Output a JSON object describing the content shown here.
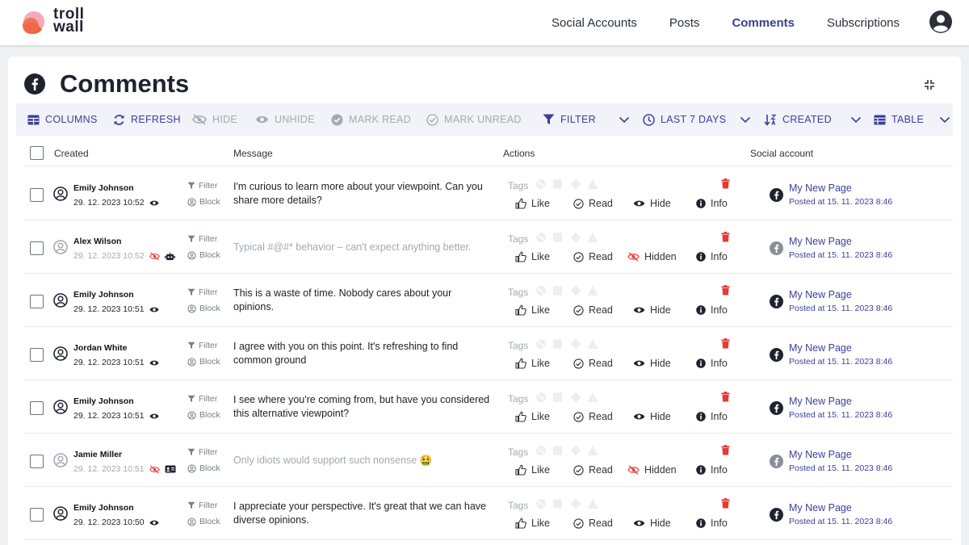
{
  "brand": {
    "line1": "troll",
    "line2": "wall"
  },
  "nav": [
    {
      "label": "Social Accounts",
      "active": false
    },
    {
      "label": "Posts",
      "active": false
    },
    {
      "label": "Comments",
      "active": true
    },
    {
      "label": "Subscriptions",
      "active": false
    }
  ],
  "page": {
    "title": "Comments"
  },
  "toolbar": {
    "columns": "COLUMNS",
    "refresh": "REFRESH",
    "hide": "HIDE",
    "unhide": "UNHIDE",
    "mark_read": "MARK READ",
    "mark_unread": "MARK UNREAD",
    "filter": "FILTER",
    "period": "LAST 7 DAYS",
    "sort": "CREATED",
    "view": "TABLE"
  },
  "table": {
    "headers": {
      "created": "Created",
      "message": "Message",
      "actions": "Actions",
      "social": "Social account"
    },
    "labels": {
      "filter": "Filter",
      "block": "Block",
      "tags": "Tags",
      "like": "Like",
      "read": "Read",
      "hide": "Hide",
      "hidden": "Hidden",
      "info": "Info"
    },
    "rows": [
      {
        "name": "Emily Johnson",
        "date": "29. 12. 2023 10:52",
        "message": "I'm curious to learn more about your viewpoint. Can you share more details?",
        "hidden": false,
        "badge": "",
        "account": "My New Page",
        "posted": "Posted at 15. 11. 2023 8:46"
      },
      {
        "name": "Alex Wilson",
        "date": "29. 12. 2023 10:52",
        "message": "Typical #@#* behavior – can't expect anything better.",
        "hidden": true,
        "badge": "bot",
        "account": "My New Page",
        "posted": "Posted at 15. 11. 2023 8:46"
      },
      {
        "name": "Emily Johnson",
        "date": "29. 12. 2023 10:51",
        "message": "This is a waste of time. Nobody cares about your opinions.",
        "hidden": false,
        "badge": "",
        "account": "My New Page",
        "posted": "Posted at 15. 11. 2023 8:46"
      },
      {
        "name": "Jordan White",
        "date": "29. 12. 2023 10:51",
        "message": "I agree with you on this point. It's refreshing to find common ground",
        "hidden": false,
        "badge": "",
        "account": "My New Page",
        "posted": "Posted at 15. 11. 2023 8:46"
      },
      {
        "name": "Emily Johnson",
        "date": "29. 12. 2023 10:51",
        "message": "I see where you're coming from, but have you considered this alternative viewpoint?",
        "hidden": false,
        "badge": "",
        "account": "My New Page",
        "posted": "Posted at 15. 11. 2023 8:46"
      },
      {
        "name": "Jamie Miller",
        "date": "29. 12. 2023 10:51",
        "message": "Only idiots would support such nonsense 🤮",
        "hidden": true,
        "badge": "id",
        "account": "My New Page",
        "posted": "Posted at 15. 11. 2023 8:46"
      },
      {
        "name": "Emily Johnson",
        "date": "29. 12. 2023 10:50",
        "message": "I appreciate your perspective. It's great that we can have diverse opinions.",
        "hidden": false,
        "badge": "",
        "account": "My New Page",
        "posted": "Posted at 15. 11. 2023 8:46"
      }
    ]
  },
  "colors": {
    "accent": "#3a3f9e",
    "muted": "#a5a8b3",
    "delete": "#e53935",
    "facebook": "#1f2330"
  },
  "icons": {
    "columns": "columns-icon",
    "refresh": "refresh-icon",
    "hide": "eye-off-icon",
    "unhide": "eye-icon",
    "filter": "funnel-icon",
    "period": "clock-icon",
    "sort": "sort-icon",
    "view": "table-icon"
  }
}
